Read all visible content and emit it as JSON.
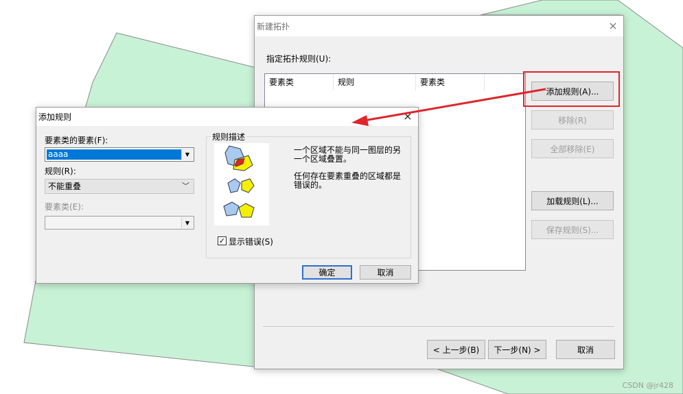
{
  "colors": {
    "map_polygon": "#c8f2d6",
    "map_outline": "#8a8a8a",
    "annotation_red": "#e0242a",
    "accent": "#0078d7"
  },
  "topology_dialog": {
    "title": "新建拓扑",
    "close_glyph": "×",
    "rules_label": "指定拓扑规则(U):",
    "columns": [
      "要素类",
      "规则",
      "要素类"
    ],
    "buttons": {
      "add_rule": "添加规则(A)...",
      "remove": "移除(R)",
      "remove_all": "全部移除(E)",
      "load_rules": "加载规则(L)...",
      "save_rules": "保存规则(S)...",
      "back": "< 上一步(B)",
      "next": "下一步(N) >",
      "cancel": "取消"
    }
  },
  "add_rule_dialog": {
    "title": "添加规则",
    "close_glyph": "×",
    "feature_label": "要素类的要素(F):",
    "feature_value": "aaaa",
    "rule_label": "规则(R):",
    "rule_value": "不能重叠",
    "feature_class_label": "要素类(E):",
    "feature_class_value": "",
    "description_title": "规则描述",
    "description_text_1a": "一个区域不能与同一图层的另",
    "description_text_1b": "一个区域叠置。",
    "description_text_2a": "任何存在要素重叠的区域都是",
    "description_text_2b": "错误的。",
    "show_errors_label": "显示错误(S)",
    "show_errors_checked": true,
    "ok": "确定",
    "cancel": "取消"
  },
  "watermark": "CSDN @jr428"
}
